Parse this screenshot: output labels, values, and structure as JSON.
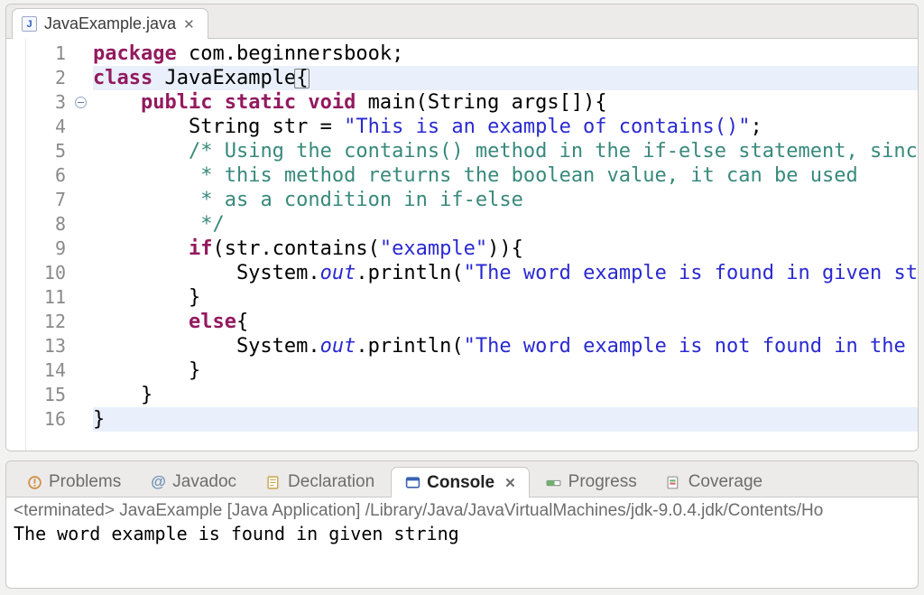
{
  "editor": {
    "tab": {
      "filename": "JavaExample.java",
      "icon_letter": "J"
    },
    "highlight_lines": [
      2,
      16
    ],
    "fold_at_line": 3,
    "lines": [
      {
        "n": 1,
        "tokens": [
          [
            "kw",
            "package "
          ],
          [
            "pkg",
            "com.beginnersbook"
          ],
          [
            "plain",
            ";"
          ]
        ]
      },
      {
        "n": 2,
        "tokens": [
          [
            "kw",
            "class "
          ],
          [
            "cls",
            "JavaExample"
          ],
          [
            "bracebox",
            "{"
          ]
        ]
      },
      {
        "n": 3,
        "tokens": [
          [
            "plain",
            "    "
          ],
          [
            "kw",
            "public static void "
          ],
          [
            "mth",
            "main"
          ],
          [
            "plain",
            "(String args[]){"
          ]
        ]
      },
      {
        "n": 4,
        "tokens": [
          [
            "plain",
            "        String str = "
          ],
          [
            "str",
            "\"This is an example of contains()\""
          ],
          [
            "plain",
            ";"
          ]
        ]
      },
      {
        "n": 5,
        "tokens": [
          [
            "plain",
            "        "
          ],
          [
            "cmt",
            "/* Using the contains() method in the if-else statement, since"
          ]
        ]
      },
      {
        "n": 6,
        "tokens": [
          [
            "plain",
            "        "
          ],
          [
            "cmt",
            " * this method returns the boolean value, it can be used"
          ]
        ]
      },
      {
        "n": 7,
        "tokens": [
          [
            "plain",
            "        "
          ],
          [
            "cmt",
            " * as a condition in if-else"
          ]
        ]
      },
      {
        "n": 8,
        "tokens": [
          [
            "plain",
            "        "
          ],
          [
            "cmt",
            " */"
          ]
        ]
      },
      {
        "n": 9,
        "tokens": [
          [
            "plain",
            "        "
          ],
          [
            "kw",
            "if"
          ],
          [
            "plain",
            "(str.contains("
          ],
          [
            "str",
            "\"example\""
          ],
          [
            "plain",
            ")){"
          ]
        ]
      },
      {
        "n": 10,
        "tokens": [
          [
            "plain",
            "            System."
          ],
          [
            "field",
            "out"
          ],
          [
            "plain",
            ".println("
          ],
          [
            "str",
            "\"The word example is found in given string\""
          ],
          [
            "plain",
            ");"
          ]
        ]
      },
      {
        "n": 11,
        "tokens": [
          [
            "plain",
            "        }"
          ]
        ]
      },
      {
        "n": 12,
        "tokens": [
          [
            "plain",
            "        "
          ],
          [
            "kw",
            "else"
          ],
          [
            "plain",
            "{"
          ]
        ]
      },
      {
        "n": 13,
        "tokens": [
          [
            "plain",
            "            System."
          ],
          [
            "field",
            "out"
          ],
          [
            "plain",
            ".println("
          ],
          [
            "str",
            "\"The word example is not found in the string\""
          ],
          [
            "plain",
            ");"
          ]
        ]
      },
      {
        "n": 14,
        "tokens": [
          [
            "plain",
            "        }"
          ]
        ]
      },
      {
        "n": 15,
        "tokens": [
          [
            "plain",
            "    }"
          ]
        ]
      },
      {
        "n": 16,
        "tokens": [
          [
            "plain",
            "}"
          ]
        ]
      }
    ]
  },
  "bottom_tabs": {
    "items": [
      {
        "id": "problems",
        "label": "Problems",
        "icon": "problems"
      },
      {
        "id": "javadoc",
        "label": "Javadoc",
        "icon": "javadoc"
      },
      {
        "id": "declaration",
        "label": "Declaration",
        "icon": "decl"
      },
      {
        "id": "console",
        "label": "Console",
        "icon": "console",
        "active": true,
        "closable": true
      },
      {
        "id": "progress",
        "label": "Progress",
        "icon": "progress"
      },
      {
        "id": "coverage",
        "label": "Coverage",
        "icon": "coverage"
      }
    ]
  },
  "console": {
    "status": "<terminated> JavaExample [Java Application] /Library/Java/JavaVirtualMachines/jdk-9.0.4.jdk/Contents/Ho",
    "output": "The word example is found in given string"
  }
}
